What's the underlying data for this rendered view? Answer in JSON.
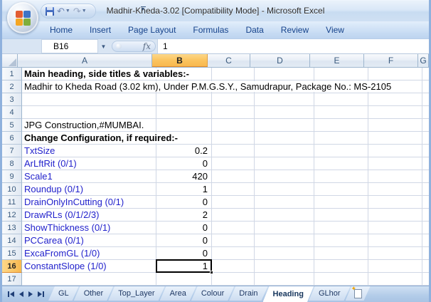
{
  "window": {
    "title": "Madhir-Kheda-3.02  [Compatibility Mode] - Microsoft Excel"
  },
  "quick_access": {
    "buttons": [
      {
        "name": "save",
        "icon": "save-icon"
      },
      {
        "name": "undo",
        "icon": "undo-icon",
        "glyph": "↶"
      },
      {
        "name": "redo",
        "icon": "redo-icon",
        "glyph": "↷"
      }
    ],
    "customize_icon": "customize-quick-access-icon"
  },
  "ribbon": {
    "tabs": [
      "Home",
      "Insert",
      "Page Layout",
      "Formulas",
      "Data",
      "Review",
      "View"
    ]
  },
  "formula_bar": {
    "name_box": "B16",
    "fx_label": "fx",
    "value": "1"
  },
  "grid": {
    "selected_cell": "B16",
    "selected_column": "B",
    "selected_row": 16,
    "columns": [
      "A",
      "B",
      "C",
      "D",
      "E",
      "F",
      "G"
    ],
    "rows": [
      {
        "n": 1,
        "a": "Main heading, side titles & variables:-",
        "b": "",
        "bold": true
      },
      {
        "n": 2,
        "a": "Madhir to Kheda Road (3.02 km), Under P.M.G.S.Y., Samudrapur, Package No.: MS-2105",
        "b": ""
      },
      {
        "n": 3,
        "a": "",
        "b": ""
      },
      {
        "n": 4,
        "a": "",
        "b": ""
      },
      {
        "n": 5,
        "a": "JPG Construction,#MUMBAI.",
        "b": ""
      },
      {
        "n": 6,
        "a": "Change Configuration, if required:-",
        "b": "",
        "bold": true
      },
      {
        "n": 7,
        "a": "TxtSize",
        "b": "0.2",
        "blue": true
      },
      {
        "n": 8,
        "a": "ArLftRit (0/1)",
        "b": "0",
        "blue": true
      },
      {
        "n": 9,
        "a": "Scale1",
        "b": "420",
        "blue": true
      },
      {
        "n": 10,
        "a": "Roundup (0/1)",
        "b": "1",
        "blue": true
      },
      {
        "n": 11,
        "a": "DrainOnlyInCutting (0/1)",
        "b": "0",
        "blue": true
      },
      {
        "n": 12,
        "a": "DrawRLs (0/1/2/3)",
        "b": "2",
        "blue": true
      },
      {
        "n": 13,
        "a": "ShowThickness (0/1)",
        "b": "0",
        "blue": true
      },
      {
        "n": 14,
        "a": "PCCarea (0/1)",
        "b": "0",
        "blue": true
      },
      {
        "n": 15,
        "a": "ExcaFromGL (1/0)",
        "b": "0",
        "blue": true
      },
      {
        "n": 16,
        "a": "ConstantSlope (1/0)",
        "b": "1",
        "blue": true,
        "selected": true
      },
      {
        "n": 17,
        "a": "",
        "b": ""
      }
    ]
  },
  "sheet_bar": {
    "nav_icons": [
      "first-sheet-icon",
      "previous-sheet-icon",
      "next-sheet-icon",
      "last-sheet-icon"
    ],
    "tabs": [
      "GL",
      "Other",
      "Top_Layer",
      "Area",
      "Colour",
      "Drain",
      "Heading",
      "GLhor"
    ],
    "active_tab": "Heading",
    "insert_tab_icon": "insert-worksheet-icon"
  },
  "colors": {
    "selection_orange": "#f8b84e",
    "ribbon_text_blue": "#15428b",
    "cell_label_blue": "#2222cc",
    "gridline": "#d0d7e5",
    "titlebar_blue": "#cfe0f3"
  }
}
